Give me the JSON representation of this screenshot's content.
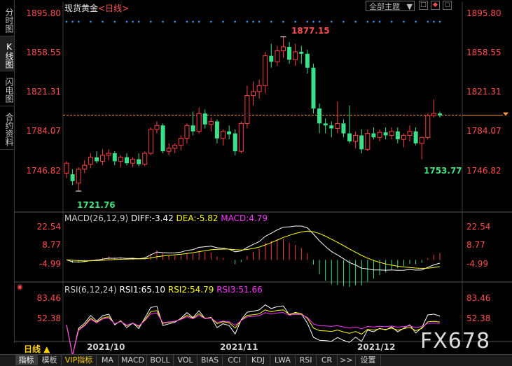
{
  "sidebar": {
    "tabs": [
      {
        "label": "分时图",
        "active": false
      },
      {
        "label": "K线图",
        "active": true
      },
      {
        "label": "闪电图",
        "active": false
      },
      {
        "label": "合约资料",
        "active": false
      }
    ]
  },
  "header": {
    "title": "现货黄金",
    "period": "<日线>",
    "theme_select": "全部主题",
    "theme_arrow": "▼",
    "win_buttons": [
      "□",
      "◆",
      "◻"
    ]
  },
  "main_chart": {
    "y_labels": [
      "1895.80",
      "1858.55",
      "1821.31",
      "1784.07",
      "1746.82"
    ],
    "high_label": "1877.15",
    "low_label": "1721.76",
    "recent_low_label": "1753.77",
    "current_price_line": 1798.3
  },
  "macd": {
    "title": "MACD(26,12,9)",
    "diff": "DIFF:-3.42",
    "dea": "DEA:-5.82",
    "macd": "MACD:4.79",
    "y_labels": [
      "22.54",
      "8.77",
      "-4.99"
    ],
    "colors": {
      "diff": "#ffffff",
      "dea": "#ffff00",
      "macd": "#ff33ff"
    }
  },
  "rsi": {
    "title": "RSI(6,12,24)",
    "rsi1": "RSI1:65.10",
    "rsi2": "RSI2:54.79",
    "rsi3": "RSI3:51.66",
    "y_labels": [
      "83.46",
      "52.38"
    ],
    "colors": {
      "rsi1": "#ffffff",
      "rsi2": "#ffff00",
      "rsi3": "#ff33ff"
    }
  },
  "x_axis": {
    "period_label": "日线 ▲",
    "dates": [
      "2021/10",
      "2021/11",
      "2021/12"
    ]
  },
  "bottom_tabs": [
    {
      "label": "指标",
      "active": true,
      "vip": false
    },
    {
      "label": "模板",
      "active": false,
      "vip": false
    },
    {
      "label": "VIP指标",
      "active": false,
      "vip": true
    },
    {
      "label": "MA",
      "active": false,
      "vip": false
    },
    {
      "label": "MACD",
      "active": false,
      "vip": false
    },
    {
      "label": "BOLL",
      "active": false,
      "vip": false
    },
    {
      "label": "VOL",
      "active": false,
      "vip": false
    },
    {
      "label": "BIAS",
      "active": false,
      "vip": false
    },
    {
      "label": "CCI",
      "active": false,
      "vip": false
    },
    {
      "label": "KDJ",
      "active": false,
      "vip": false
    },
    {
      "label": "LWA",
      "active": false,
      "vip": false
    },
    {
      "label": "RSI",
      "active": false,
      "vip": false
    },
    {
      "label": "CR",
      "active": false,
      "vip": false
    },
    {
      "label": ">>",
      "active": false,
      "vip": false
    },
    {
      "label": "设置",
      "active": false,
      "vip": false
    }
  ],
  "watermark": "FX678",
  "chart_data": {
    "type": "candlestick",
    "ylim": [
      1715,
      1900
    ],
    "candles": [
      {
        "o": 1740,
        "h": 1752,
        "l": 1735,
        "c": 1750
      },
      {
        "o": 1739,
        "h": 1744,
        "l": 1728,
        "c": 1732
      },
      {
        "o": 1730,
        "h": 1746,
        "l": 1722,
        "c": 1744
      },
      {
        "o": 1744,
        "h": 1753,
        "l": 1740,
        "c": 1748
      },
      {
        "o": 1749,
        "h": 1760,
        "l": 1745,
        "c": 1756
      },
      {
        "o": 1756,
        "h": 1762,
        "l": 1750,
        "c": 1752
      },
      {
        "o": 1752,
        "h": 1764,
        "l": 1748,
        "c": 1758
      },
      {
        "o": 1758,
        "h": 1764,
        "l": 1753,
        "c": 1760
      },
      {
        "o": 1760,
        "h": 1762,
        "l": 1748,
        "c": 1752
      },
      {
        "o": 1752,
        "h": 1758,
        "l": 1746,
        "c": 1756
      },
      {
        "o": 1756,
        "h": 1760,
        "l": 1748,
        "c": 1750
      },
      {
        "o": 1750,
        "h": 1756,
        "l": 1746,
        "c": 1754
      },
      {
        "o": 1754,
        "h": 1760,
        "l": 1747,
        "c": 1749
      },
      {
        "o": 1749,
        "h": 1762,
        "l": 1747,
        "c": 1760
      },
      {
        "o": 1760,
        "h": 1786,
        "l": 1758,
        "c": 1784
      },
      {
        "o": 1784,
        "h": 1792,
        "l": 1780,
        "c": 1788
      },
      {
        "o": 1788,
        "h": 1790,
        "l": 1760,
        "c": 1762
      },
      {
        "o": 1762,
        "h": 1770,
        "l": 1758,
        "c": 1765
      },
      {
        "o": 1765,
        "h": 1770,
        "l": 1760,
        "c": 1768
      },
      {
        "o": 1768,
        "h": 1778,
        "l": 1763,
        "c": 1775
      },
      {
        "o": 1775,
        "h": 1790,
        "l": 1770,
        "c": 1788
      },
      {
        "o": 1788,
        "h": 1802,
        "l": 1778,
        "c": 1782
      },
      {
        "o": 1782,
        "h": 1806,
        "l": 1780,
        "c": 1800
      },
      {
        "o": 1800,
        "h": 1804,
        "l": 1785,
        "c": 1789
      },
      {
        "o": 1789,
        "h": 1796,
        "l": 1782,
        "c": 1792
      },
      {
        "o": 1792,
        "h": 1794,
        "l": 1770,
        "c": 1775
      },
      {
        "o": 1775,
        "h": 1784,
        "l": 1768,
        "c": 1782
      },
      {
        "o": 1782,
        "h": 1788,
        "l": 1774,
        "c": 1779
      },
      {
        "o": 1780,
        "h": 1784,
        "l": 1758,
        "c": 1762
      },
      {
        "o": 1762,
        "h": 1792,
        "l": 1760,
        "c": 1790
      },
      {
        "o": 1790,
        "h": 1828,
        "l": 1785,
        "c": 1818
      },
      {
        "o": 1818,
        "h": 1832,
        "l": 1808,
        "c": 1822
      },
      {
        "o": 1822,
        "h": 1834,
        "l": 1815,
        "c": 1828
      },
      {
        "o": 1828,
        "h": 1862,
        "l": 1820,
        "c": 1858
      },
      {
        "o": 1858,
        "h": 1870,
        "l": 1846,
        "c": 1852
      },
      {
        "o": 1852,
        "h": 1868,
        "l": 1848,
        "c": 1863
      },
      {
        "o": 1863,
        "h": 1877,
        "l": 1856,
        "c": 1867
      },
      {
        "o": 1867,
        "h": 1872,
        "l": 1850,
        "c": 1854
      },
      {
        "o": 1854,
        "h": 1870,
        "l": 1848,
        "c": 1862
      },
      {
        "o": 1862,
        "h": 1868,
        "l": 1850,
        "c": 1860
      },
      {
        "o": 1860,
        "h": 1864,
        "l": 1840,
        "c": 1846
      },
      {
        "o": 1846,
        "h": 1850,
        "l": 1800,
        "c": 1805
      },
      {
        "o": 1805,
        "h": 1810,
        "l": 1780,
        "c": 1790
      },
      {
        "o": 1790,
        "h": 1795,
        "l": 1780,
        "c": 1788
      },
      {
        "o": 1788,
        "h": 1792,
        "l": 1776,
        "c": 1785
      },
      {
        "o": 1785,
        "h": 1812,
        "l": 1780,
        "c": 1790
      },
      {
        "o": 1790,
        "h": 1794,
        "l": 1776,
        "c": 1780
      },
      {
        "o": 1780,
        "h": 1808,
        "l": 1770,
        "c": 1772
      },
      {
        "o": 1772,
        "h": 1782,
        "l": 1765,
        "c": 1778
      },
      {
        "o": 1778,
        "h": 1784,
        "l": 1760,
        "c": 1764
      },
      {
        "o": 1764,
        "h": 1784,
        "l": 1762,
        "c": 1780
      },
      {
        "o": 1780,
        "h": 1786,
        "l": 1774,
        "c": 1776
      },
      {
        "o": 1776,
        "h": 1784,
        "l": 1772,
        "c": 1781
      },
      {
        "o": 1781,
        "h": 1786,
        "l": 1774,
        "c": 1778
      },
      {
        "o": 1778,
        "h": 1786,
        "l": 1774,
        "c": 1782
      },
      {
        "o": 1782,
        "h": 1786,
        "l": 1770,
        "c": 1774
      },
      {
        "o": 1774,
        "h": 1780,
        "l": 1766,
        "c": 1778
      },
      {
        "o": 1778,
        "h": 1788,
        "l": 1772,
        "c": 1782
      },
      {
        "o": 1782,
        "h": 1786,
        "l": 1768,
        "c": 1770
      },
      {
        "o": 1770,
        "h": 1776,
        "l": 1754,
        "c": 1776
      },
      {
        "o": 1776,
        "h": 1800,
        "l": 1774,
        "c": 1798
      },
      {
        "o": 1798,
        "h": 1814,
        "l": 1796,
        "c": 1800
      },
      {
        "o": 1800,
        "h": 1802,
        "l": 1796,
        "c": 1798
      }
    ]
  }
}
